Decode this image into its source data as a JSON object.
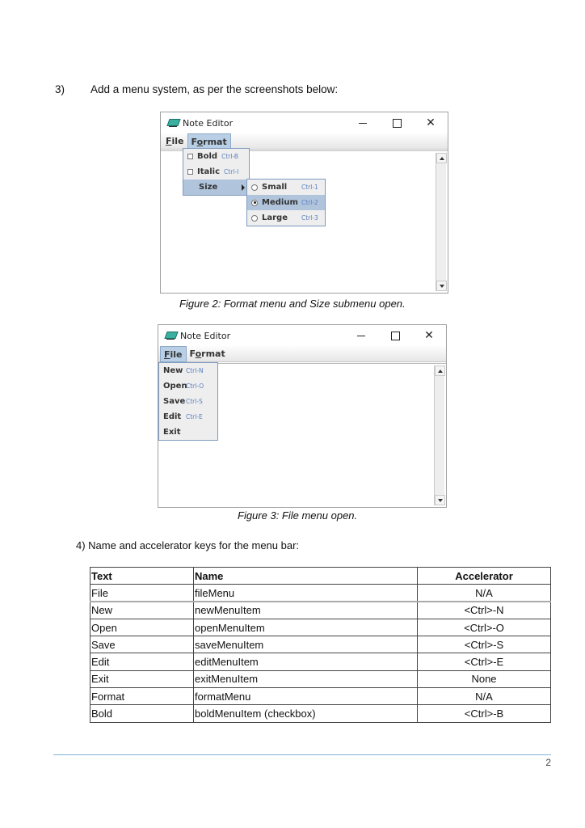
{
  "step3": {
    "number": "3)",
    "text": "Add a menu system, as per the screenshots below:"
  },
  "figure2": {
    "window_title": "Note Editor",
    "menus": [
      "File",
      "Format"
    ],
    "active_menu": "Format",
    "format_items": [
      {
        "label": "Bold",
        "accel": "Ctrl-B",
        "type": "checkbox",
        "checked": false
      },
      {
        "label": "Italic",
        "accel": "Ctrl-I",
        "type": "checkbox",
        "checked": false
      },
      {
        "label": "Size",
        "accel": "",
        "type": "submenu",
        "highlighted": true
      }
    ],
    "size_items": [
      {
        "label": "Small",
        "accel": "Ctrl-1",
        "selected": false
      },
      {
        "label": "Medium",
        "accel": "Ctrl-2",
        "selected": true
      },
      {
        "label": "Large",
        "accel": "Ctrl-3",
        "selected": false
      }
    ],
    "caption": "Figure 2: Format menu and Size submenu open."
  },
  "figure3": {
    "window_title": "Note Editor",
    "menus": [
      "File",
      "Format"
    ],
    "active_menu": "File",
    "file_items": [
      {
        "label": "New",
        "accel": "Ctrl-N"
      },
      {
        "label": "Open",
        "accel": "Ctrl-O"
      },
      {
        "label": "Save",
        "accel": "Ctrl-S"
      },
      {
        "label": "Edit",
        "accel": "Ctrl-E"
      },
      {
        "label": "Exit",
        "accel": ""
      }
    ],
    "caption": "Figure 3: File menu open."
  },
  "step4": {
    "text": "4)  Name and accelerator keys for the menu bar:"
  },
  "table": {
    "headers": [
      "Text",
      "Name",
      "Accelerator"
    ],
    "rows": [
      [
        "File",
        "fileMenu",
        "N/A"
      ],
      [
        "New",
        "newMenuItem",
        "<Ctrl>-N"
      ],
      [
        "Open",
        "openMenuItem",
        "<Ctrl>-O"
      ],
      [
        "Save",
        "saveMenuItem",
        "<Ctrl>-S"
      ],
      [
        "Edit",
        "editMenuItem",
        "<Ctrl>-E"
      ],
      [
        "Exit",
        "exitMenuItem",
        "None"
      ],
      [
        "Format",
        "formatMenu",
        "N/A"
      ],
      [
        "Bold",
        "boldMenuItem (checkbox)",
        "<Ctrl>-B"
      ]
    ]
  },
  "footer": {
    "page_number": "2"
  }
}
